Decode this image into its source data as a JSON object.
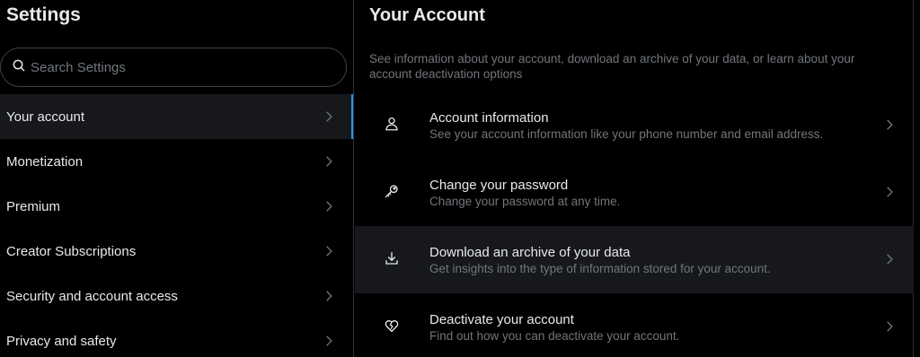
{
  "left": {
    "title": "Settings",
    "search_placeholder": "Search Settings",
    "items": [
      {
        "label": "Your account"
      },
      {
        "label": "Monetization"
      },
      {
        "label": "Premium"
      },
      {
        "label": "Creator Subscriptions"
      },
      {
        "label": "Security and account access"
      },
      {
        "label": "Privacy and safety"
      }
    ]
  },
  "right": {
    "title": "Your Account",
    "description": "See information about your account, download an archive of your data, or learn about your account deactivation options",
    "options": [
      {
        "title": "Account information",
        "subtitle": "See your account information like your phone number and email address.",
        "icon": "person-icon"
      },
      {
        "title": "Change your password",
        "subtitle": "Change your password at any time.",
        "icon": "key-icon"
      },
      {
        "title": "Download an archive of your data",
        "subtitle": "Get insights into the type of information stored for your account.",
        "icon": "download-icon"
      },
      {
        "title": "Deactivate your account",
        "subtitle": "Find out how you can deactivate your account.",
        "icon": "broken-heart-icon"
      }
    ]
  },
  "colors": {
    "background": "#000000",
    "text_primary": "#e7e9ea",
    "text_secondary": "#71767b",
    "highlight": "#16181c",
    "accent": "#1d9bf0",
    "border": "#2f3336"
  }
}
